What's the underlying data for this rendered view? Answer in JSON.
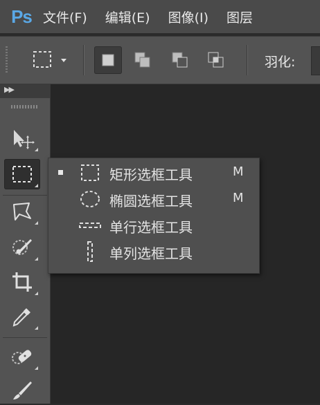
{
  "app": {
    "logo": "Ps"
  },
  "menubar": {
    "items": [
      "文件(F)",
      "编辑(E)",
      "图像(I)",
      "图层"
    ]
  },
  "options": {
    "tool_icon": "rect-marquee-icon",
    "selection_modes": [
      "new-selection-icon",
      "add-to-selection-icon",
      "subtract-from-selection-icon",
      "intersect-selection-icon"
    ],
    "active_mode_index": 0,
    "feather_label": "羽化:"
  },
  "toolbox": {
    "tools": [
      "move-tool-icon",
      "rect-marquee-tool-icon",
      "lasso-tool-icon",
      "quick-select-tool-icon",
      "crop-tool-icon",
      "eyedropper-tool-icon",
      "healing-brush-tool-icon",
      "brush-tool-icon"
    ],
    "active_index": 1
  },
  "flyout": {
    "items": [
      {
        "icon": "rect-marquee-icon",
        "label": "矩形选框工具",
        "shortcut": "M",
        "selected": true
      },
      {
        "icon": "ellipse-marquee-icon",
        "label": "椭圆选框工具",
        "shortcut": "M",
        "selected": false
      },
      {
        "icon": "single-row-marquee-icon",
        "label": "单行选框工具",
        "shortcut": "",
        "selected": false
      },
      {
        "icon": "single-column-marquee-icon",
        "label": "单列选框工具",
        "shortcut": "",
        "selected": false
      }
    ]
  }
}
